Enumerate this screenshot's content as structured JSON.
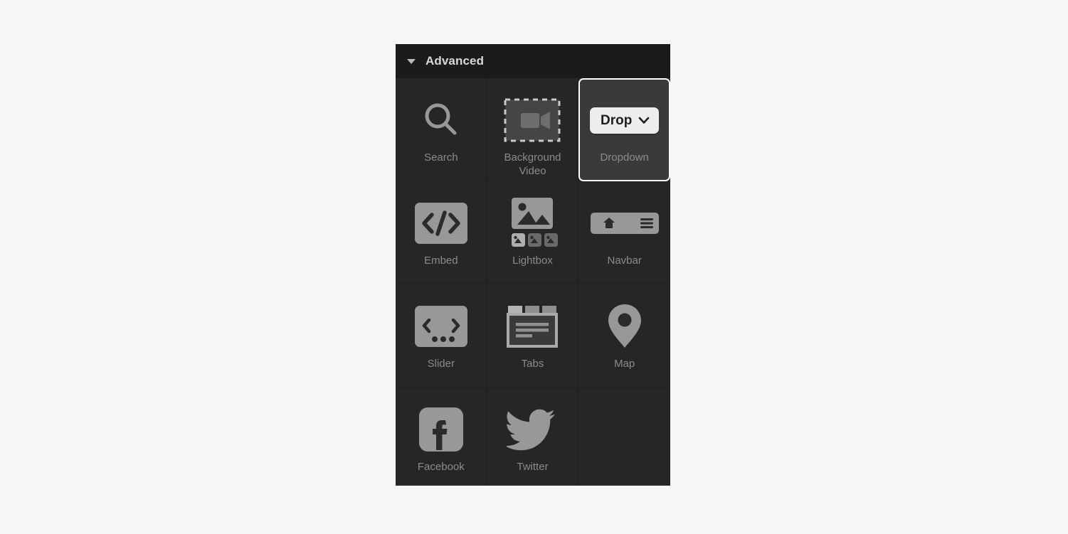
{
  "page": {
    "background_color": "#f5f6f8"
  },
  "panel": {
    "background_color": "#262626",
    "header": {
      "title": "Advanced",
      "collapse_icon": "caret-down-icon",
      "expanded": true,
      "background_color": "#1b1b1b",
      "text_color": "#d8d8d8"
    },
    "selected_item": "Dropdown",
    "selection_border_color": "#ffffff",
    "items": [
      {
        "label": "Search",
        "icon": "magnifier-icon",
        "selected": false
      },
      {
        "label": "Background\nVideo",
        "icon": "video-camera-icon",
        "selected": false
      },
      {
        "label": "Dropdown",
        "icon": "dropdown-button-icon",
        "selected": true,
        "button_text": "Drop",
        "button_chevron": "chevron-down-icon"
      },
      {
        "label": "Embed",
        "icon": "code-brackets-icon",
        "selected": false
      },
      {
        "label": "Lightbox",
        "icon": "image-gallery-icon",
        "selected": false
      },
      {
        "label": "Navbar",
        "icon": "navbar-icon",
        "selected": false
      },
      {
        "label": "Slider",
        "icon": "slider-carousel-icon",
        "selected": false
      },
      {
        "label": "Tabs",
        "icon": "tabs-icon",
        "selected": false
      },
      {
        "label": "Map",
        "icon": "map-pin-icon",
        "selected": false
      },
      {
        "label": "Facebook",
        "icon": "facebook-icon",
        "selected": false
      },
      {
        "label": "Twitter",
        "icon": "twitter-bird-icon",
        "selected": false
      },
      {
        "label": "",
        "icon": "",
        "selected": false
      }
    ],
    "colors": {
      "icon_gray": "#989898",
      "icon_dark": "#2b2b2b",
      "label_text": "#8b8b8b",
      "selected_cell_bg": "#3a3a3a",
      "drop_button_bg": "#ededed",
      "drop_button_text": "#1e1e1e"
    }
  }
}
